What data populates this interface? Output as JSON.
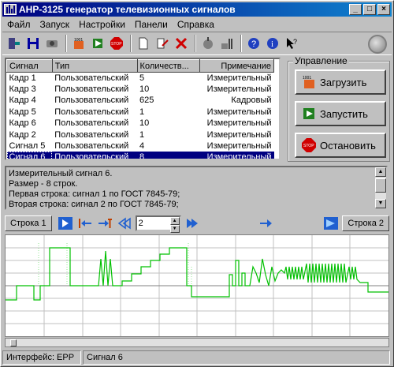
{
  "window": {
    "title": "АНР-3125 генератор телевизионных сигналов",
    "min": "_",
    "max": "□",
    "close": "×"
  },
  "menu": [
    {
      "label": "Файл"
    },
    {
      "label": "Запуск"
    },
    {
      "label": "Настройки"
    },
    {
      "label": "Панели"
    },
    {
      "label": "Справка"
    }
  ],
  "table": {
    "columns": [
      "Сигнал",
      "Тип",
      "Количеств...",
      "Примечание"
    ],
    "rows": [
      [
        "Кадр 1",
        "Пользовательский",
        "5",
        "Измерительный"
      ],
      [
        "Кадр 3",
        "Пользовательский",
        "10",
        "Измерительный"
      ],
      [
        "Кадр 4",
        "Пользовательский",
        "625",
        "Кадровый"
      ],
      [
        "Кадр 5",
        "Пользовательский",
        "1",
        "Измерительный"
      ],
      [
        "Кадр 6",
        "Пользовательский",
        "10",
        "Измерительный"
      ],
      [
        "Кадр 2",
        "Пользовательский",
        "1",
        "Измерительный"
      ],
      [
        "Сигнал 5",
        "Пользовательский",
        "4",
        "Измерительный"
      ],
      [
        "Сигнал 6",
        "Пользовательский",
        "8",
        "Измерительный"
      ]
    ],
    "selected_row": 7
  },
  "control": {
    "group_label": "Управление",
    "load": "Загрузить",
    "run": "Запустить",
    "stop": "Остановить"
  },
  "description": {
    "lines": [
      "Измерительный сигнал 6.",
      "Размер - 8 строк.",
      "Первая строка: сигнал 1 по ГОСТ 7845-79;",
      "Вторая строка: сигнал 2 по ГОСТ 7845-79;"
    ]
  },
  "nav": {
    "row_left": "Строка 1",
    "row_right": "Строка 2",
    "spin_value": "2"
  },
  "status": {
    "interface": "Интерфейс: EPP",
    "signal": "Сигнал 6"
  },
  "colors": {
    "selection": "#000080",
    "waveform": "#00c000",
    "grid": "#c0c0c0"
  }
}
